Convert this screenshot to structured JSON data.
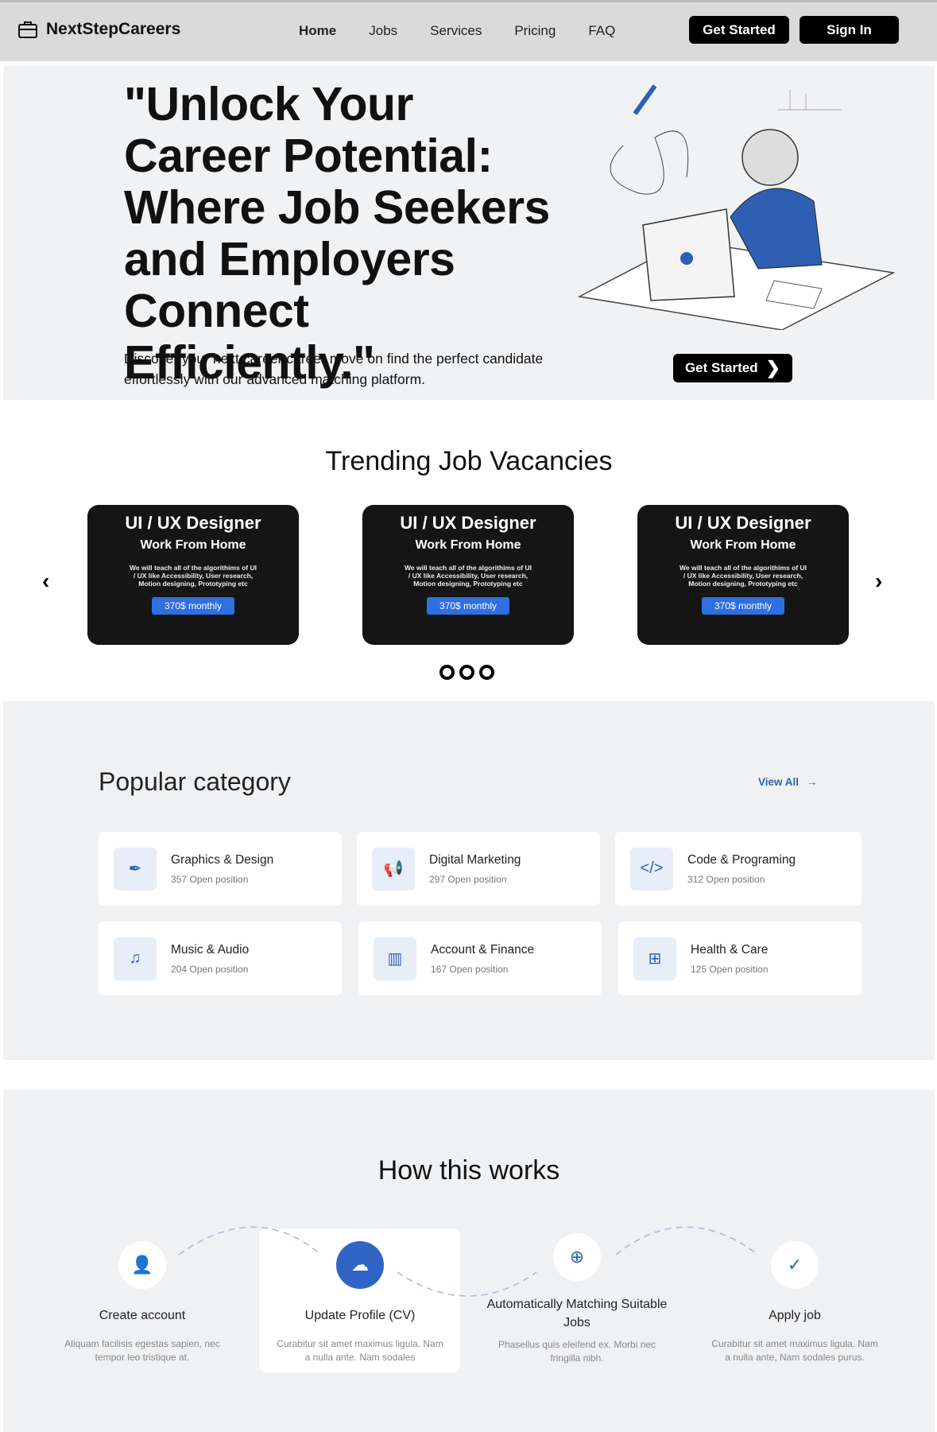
{
  "nav": {
    "brand": "NextStepCareers",
    "links": [
      "Home",
      "Jobs",
      "Services",
      "Pricing",
      "FAQ"
    ],
    "get_started": "Get Started",
    "sign_in": "Sign In"
  },
  "hero": {
    "title": "\"Unlock Your Career Potential: Where Job Seekers and Employers Connect Efficiently.\"",
    "subtitle": "Discover your next career career move on find the perfect candidate effortlessly with our advanced matching platform.",
    "cta": "Get Started"
  },
  "trending": {
    "title": "Trending Job Vacancies",
    "cards": [
      {
        "title": "UI / UX Designer",
        "type": "Work From Home",
        "desc": "We will teach all of the algorithims of UI / UX like Accessibility, User research, Motion designing, Prototyping etc",
        "price": "370$ monthly"
      },
      {
        "title": "UI / UX Designer",
        "type": "Work From Home",
        "desc": "We will teach all of the algorithims of UI / UX like Accessibility, User research, Motion designing, Prototyping etc",
        "price": "370$ monthly"
      },
      {
        "title": "UI / UX Designer",
        "type": "Work From Home",
        "desc": "We will teach all of the algorithims of UI / UX like Accessibility, User research, Motion designing, Prototyping etc",
        "price": "370$ monthly"
      }
    ]
  },
  "popular": {
    "title": "Popular category",
    "view_all": "View All",
    "categories": [
      {
        "name": "Graphics & Design",
        "count": "357 Open position",
        "icon": "pen-tool-icon"
      },
      {
        "name": "Digital Marketing",
        "count": "297 Open position",
        "icon": "megaphone-icon"
      },
      {
        "name": "Code & Programing",
        "count": "312 Open position",
        "icon": "code-icon"
      },
      {
        "name": "Music & Audio",
        "count": "204 Open position",
        "icon": "music-icon"
      },
      {
        "name": "Account & Finance",
        "count": "167 Open position",
        "icon": "bar-chart-icon"
      },
      {
        "name": "Health & Care",
        "count": "125 Open position",
        "icon": "medical-kit-icon"
      }
    ]
  },
  "how": {
    "title": "How this works",
    "steps": [
      {
        "label": "Create account",
        "desc": "Aliquam facilisis egestas sapien, nec tempor leo tristique at."
      },
      {
        "label": "Update Profile (CV)",
        "desc": "Curabitur sit amet maximus ligula. Nam a nulla ante. Nam sodales"
      },
      {
        "label": "Automatically Matching Suitable Jobs",
        "desc": "Phasellus quis eleifend ex. Morbi nec fringilla nibh."
      },
      {
        "label": "Apply job",
        "desc": "Curabitur sit amet maximus ligula. Nam a nulla ante, Nam sodales purus."
      }
    ]
  },
  "colors": {
    "accent": "#2f6fe0",
    "dark": "#151515"
  }
}
